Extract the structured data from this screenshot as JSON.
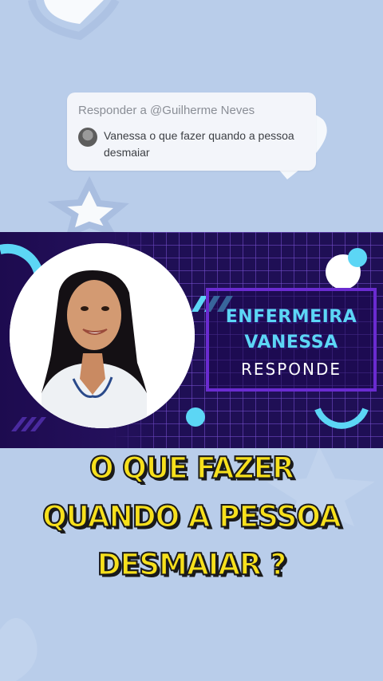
{
  "reply": {
    "header": "Responder a @Guilherme Neves",
    "comment": "Vanessa o que fazer quando a pessoa desmaiar"
  },
  "banner": {
    "line1": "ENFERMEIRA",
    "line2": "VANESSA",
    "line3": "RESPONDE"
  },
  "caption": {
    "line1": "O QUE FAZER",
    "line2": "QUANDO A PESSOA",
    "line3": "DESMAIAR ?"
  },
  "colors": {
    "background": "#b9cdea",
    "banner": "#1f0f55",
    "accent_cyan": "#5cd6f5",
    "caption_yellow": "#f7e01c"
  }
}
